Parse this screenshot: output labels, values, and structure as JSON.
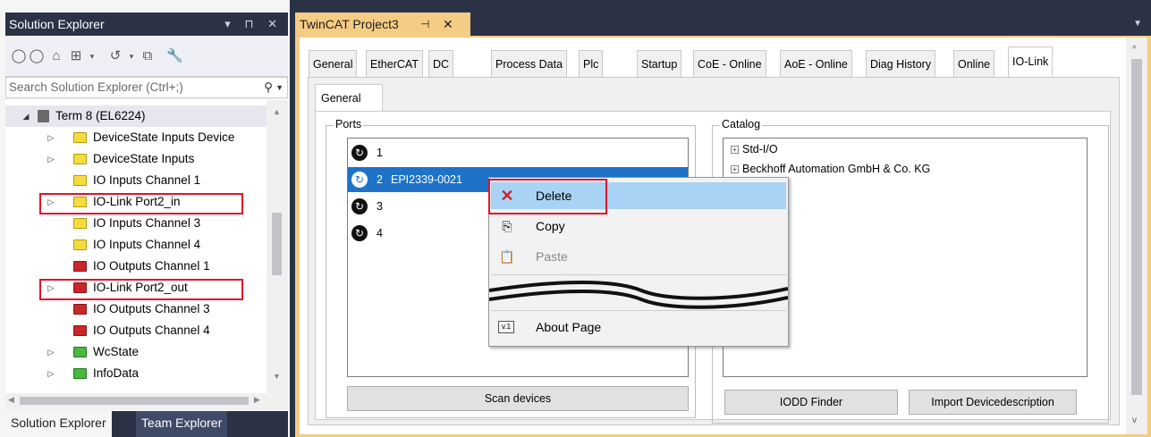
{
  "solution_explorer": {
    "title": "Solution Explorer",
    "title_controls": "▾ ⊓ ✕",
    "search_placeholder": "Search Solution Explorer (Ctrl+;)",
    "tree": [
      {
        "label": "Term 8 (EL6224)",
        "type": "root"
      },
      {
        "label": "DeviceState Inputs Device",
        "color": "yellow"
      },
      {
        "label": "DeviceState Inputs",
        "color": "yellow"
      },
      {
        "label": "IO Inputs Channel 1",
        "color": "yellow"
      },
      {
        "label": "IO-Link Port2_in",
        "color": "yellow",
        "highlighted": true
      },
      {
        "label": "IO Inputs Channel 3",
        "color": "yellow"
      },
      {
        "label": "IO Inputs Channel 4",
        "color": "yellow"
      },
      {
        "label": "IO Outputs Channel 1",
        "color": "red"
      },
      {
        "label": "IO-Link Port2_out",
        "color": "red",
        "highlighted": true
      },
      {
        "label": "IO Outputs Channel 3",
        "color": "red"
      },
      {
        "label": "IO Outputs Channel 4",
        "color": "red"
      },
      {
        "label": "WcState",
        "color": "green"
      },
      {
        "label": "InfoData",
        "color": "green"
      }
    ],
    "bottom_tabs": [
      "Solution Explorer",
      "Team Explorer"
    ]
  },
  "document": {
    "tab_title": "TwinCAT Project3",
    "tabs": [
      "General",
      "EtherCAT",
      "DC",
      "Process Data",
      "Plc",
      "Startup",
      "CoE - Online",
      "AoE - Online",
      "Diag History",
      "Online",
      "IO-Link"
    ],
    "active_tab": "IO-Link",
    "subtab": "General",
    "ports_title": "Ports",
    "ports": [
      {
        "num": "1",
        "device": ""
      },
      {
        "num": "2",
        "device": "EPI2339-0021"
      },
      {
        "num": "3",
        "device": ""
      },
      {
        "num": "4",
        "device": ""
      }
    ],
    "catalog_title": "Catalog",
    "catalog": [
      "Std-I/O",
      "Beckhoff Automation GmbH & Co. KG"
    ],
    "scan_button": "Scan devices",
    "iodd_button": "IODD Finder",
    "import_button": "Import Devicedescription"
  },
  "context_menu": {
    "items": [
      "Delete",
      "Copy",
      "Paste",
      "About Page"
    ]
  },
  "colors": {
    "accent": "#f5cc84",
    "selection": "#1e73c8",
    "menu_highlight": "#a9d3f5",
    "callout": "#e0142b"
  }
}
